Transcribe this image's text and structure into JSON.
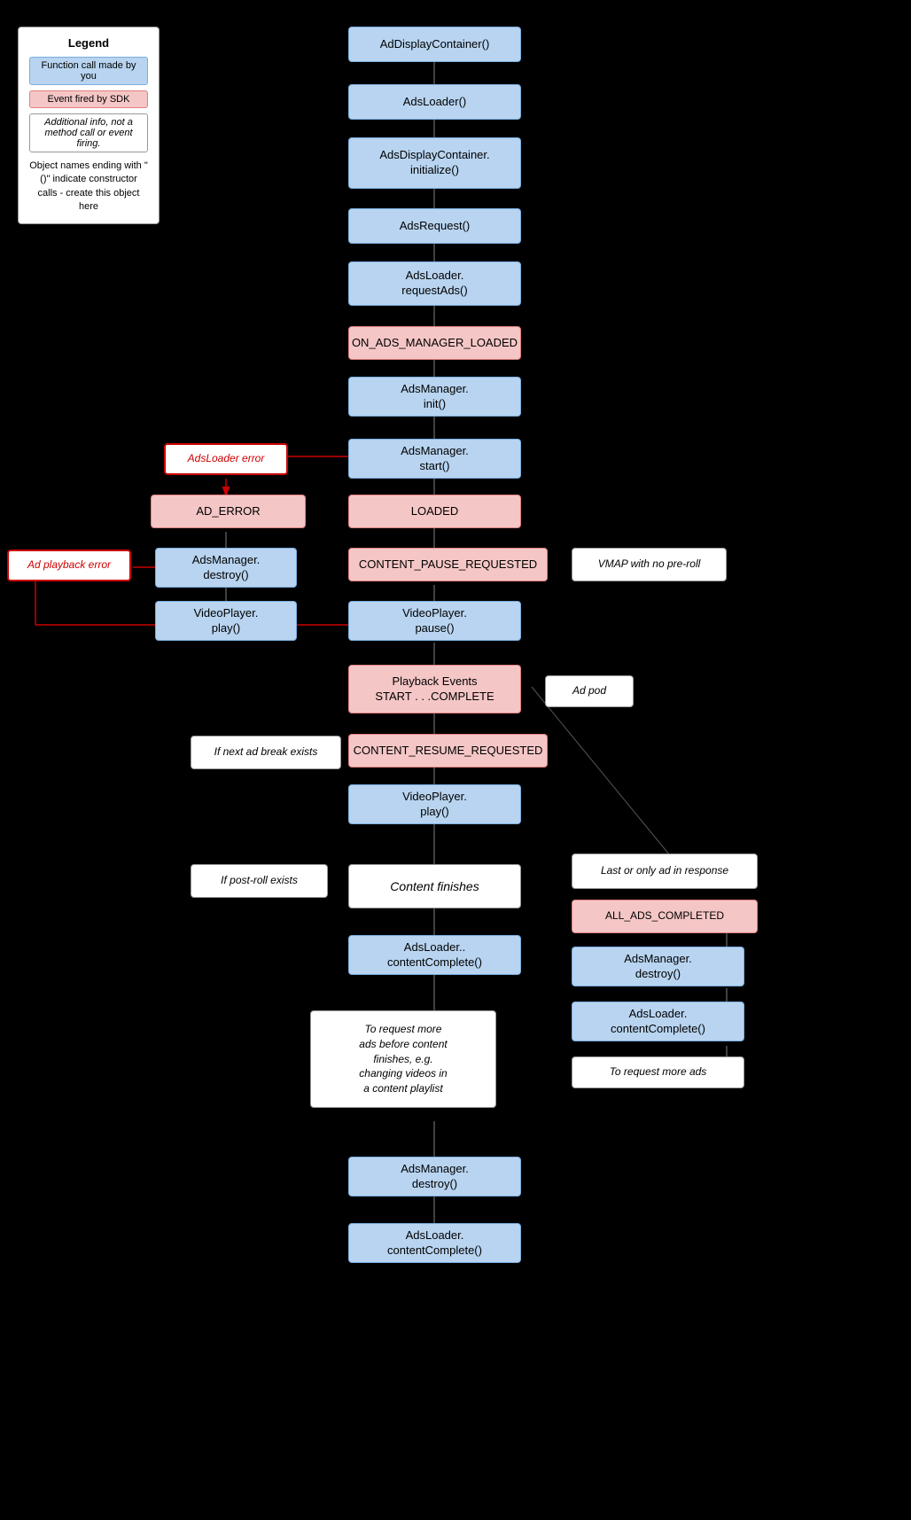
{
  "legend": {
    "title": "Legend",
    "item1": "Function call made by you",
    "item2": "Event fired by SDK",
    "item3": "Additional info, not a method call or event firing.",
    "note": "Object names ending with \"()\" indicate constructor calls - create this object here"
  },
  "boxes": {
    "adDisplayContainer": "AdDisplayContainer()",
    "adsLoader": "AdsLoader()",
    "adsDisplayContainerInit": "AdsDisplayContainer.\ninitialize()",
    "adsRequest": "AdsRequest()",
    "adsLoaderRequestAds": "AdsLoader.\nrequestAds()",
    "onAdsManagerLoaded": "ON_ADS_MANAGER_LOADED",
    "adsManagerInit": "AdsManager.\ninit()",
    "adsLoaderError": "AdsLoader error",
    "adsManagerStart": "AdsManager.\nstart()",
    "adError": "AD_ERROR",
    "loaded": "LOADED",
    "adsManagerDestroy1": "AdsManager.\ndestroy()",
    "contentPauseRequested": "CONTENT_PAUSE_REQUESTED",
    "vmapNoPreroll": "VMAP with no pre-roll",
    "videoPlayerPlay1": "VideoPlayer.\nplay()",
    "videoPlayerPause": "VideoPlayer.\npause()",
    "adPlaybackError": "Ad playback error",
    "playbackEvents": "Playback Events\nSTART . . .COMPLETE",
    "adPod": "Ad pod",
    "contentResumeRequested": "CONTENT_RESUME_REQUESTED",
    "ifNextAdBreak": "If next ad break exists",
    "videoPlayerPlay2": "VideoPlayer.\nplay()",
    "ifPostRollExists": "If post-roll exists",
    "contentFinishes": "Content finishes",
    "lastOrOnlyAd": "Last or only ad in response",
    "allAdsCompleted": "ALL_ADS_COMPLETED",
    "adsLoaderContentComplete1": "AdsLoader..\ncontentComplete()",
    "adsManagerDestroy2": "AdsManager.\ndestroy()",
    "adsLoaderContentComplete2": "AdsLoader.\ncontentComplete()",
    "toRequestMoreAds": "To request more ads",
    "toRequestMoreAdsBefore": "To request more\nads before content\nfinishes, e.g.\nchanging videos in\na content playlist",
    "adsManagerDestroy3": "AdsManager.\ndestroy()",
    "adsLoaderContentComplete3": "AdsLoader.\ncontentComplete()"
  }
}
